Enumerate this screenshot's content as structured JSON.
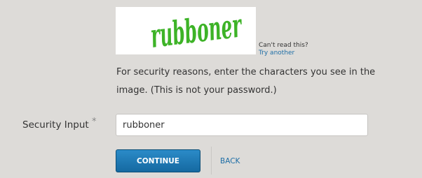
{
  "captcha": {
    "word": "rubboner",
    "ink_color": "#3db327",
    "cant_read": "Can't read this?",
    "try_another": "Try another"
  },
  "instructions": "For security reasons, enter the characters you see in the image. (This is not your password.)",
  "field": {
    "label": "Security Input",
    "required_mark": "*",
    "value": "rubboner"
  },
  "buttons": {
    "continue": "CONTINUE",
    "back": "BACK"
  },
  "colors": {
    "background": "#dddbd8",
    "primary_button": "#1f7bb8",
    "link": "#1e6ea6"
  }
}
